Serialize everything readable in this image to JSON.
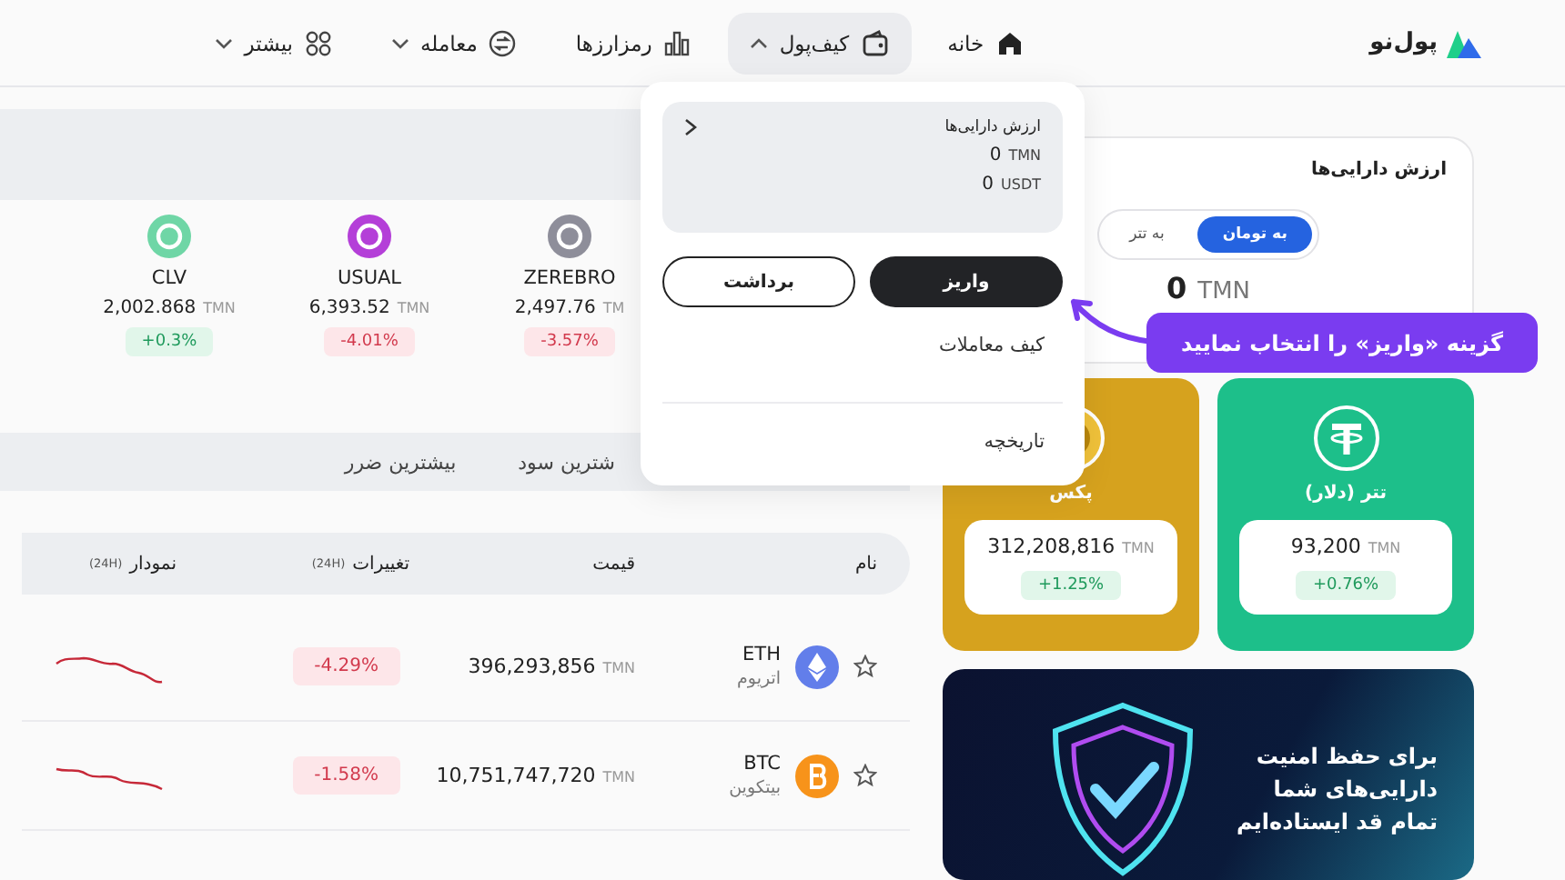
{
  "nav": {
    "logo": "پول‌نو",
    "items": [
      {
        "label": "خانه",
        "kind": "link",
        "selected": false,
        "expanded": false
      },
      {
        "label": "کیف‌پول",
        "kind": "menu",
        "selected": true,
        "expanded": true
      },
      {
        "label": "رمزارزها",
        "kind": "link",
        "selected": false,
        "expanded": false
      },
      {
        "label": "معامله",
        "kind": "menu",
        "selected": false,
        "expanded": false
      },
      {
        "label": "بیشتر",
        "kind": "menu",
        "selected": false,
        "expanded": false
      }
    ]
  },
  "movers": [
    {
      "symbol": "ZEREBRO",
      "price": "2,497.76",
      "unit": "TM",
      "change": "-3.57%",
      "rising": false,
      "color": "#8e8e9a"
    },
    {
      "symbol": "USUAL",
      "price": "6,393.52",
      "unit": "TMN",
      "change": "-4.01%",
      "rising": false,
      "color": "#b43fd8"
    },
    {
      "symbol": "CLV",
      "price": "2,002.868",
      "unit": "TMN",
      "change": "+0.3%",
      "rising": true,
      "color": "#6fd6a6"
    }
  ],
  "tabs": [
    {
      "label": "شترین سود",
      "selected": false
    },
    {
      "label": "بیشترین ضرر",
      "selected": false
    }
  ],
  "table": {
    "columns": [
      {
        "label": "نام"
      },
      {
        "label": "قیمت"
      },
      {
        "label": "تغییرات",
        "note": "(24H)"
      },
      {
        "label": "نمودار",
        "note": "(24H)"
      }
    ],
    "rows": [
      {
        "symbol": "ETH",
        "name": "اتریوم",
        "price": "396,293,856",
        "unit": "TMN",
        "change": "-4.29%",
        "rising": false,
        "favorite": false,
        "color": "#627eea"
      },
      {
        "symbol": "BTC",
        "name": "بیتکوین",
        "price": "10,751,747,720",
        "unit": "TMN",
        "change": "-1.58%",
        "rising": false,
        "favorite": false,
        "color": "#f7931a"
      }
    ]
  },
  "asset_card": {
    "title": "ارزش دارایی‌ها",
    "toggle": [
      {
        "label": "به تومان",
        "selected": true
      },
      {
        "label": "به تتر",
        "selected": false
      }
    ],
    "amount": "0",
    "unit": "TMN"
  },
  "price_cards": [
    {
      "title": "تتر (دلار)",
      "price": "93,200",
      "unit": "TMN",
      "change": "+0.76%",
      "rising": true,
      "color": "#1dbf8a"
    },
    {
      "title": "پکس",
      "price": "312,208,816",
      "unit": "TMN",
      "change": "+1.25%",
      "rising": true,
      "color": "#d6a21e"
    }
  ],
  "banner": {
    "text": "برای حفظ امنیت دارایی‌های شما تمام قد ایستاده‌ایم"
  },
  "dropdown": {
    "assets": {
      "title": "ارزش دارایی‌ها",
      "balances": [
        {
          "amount": "0",
          "unit": "TMN"
        },
        {
          "amount": "0",
          "unit": "USDT"
        }
      ]
    },
    "buttons": [
      {
        "label": "واریز",
        "kind": "primary"
      },
      {
        "label": "برداشت",
        "kind": "outline"
      }
    ],
    "links": [
      "کیف معاملات",
      "تاریخچه"
    ]
  },
  "callout": {
    "text": "گزینه «واریز» را انتخاب نمایید"
  }
}
